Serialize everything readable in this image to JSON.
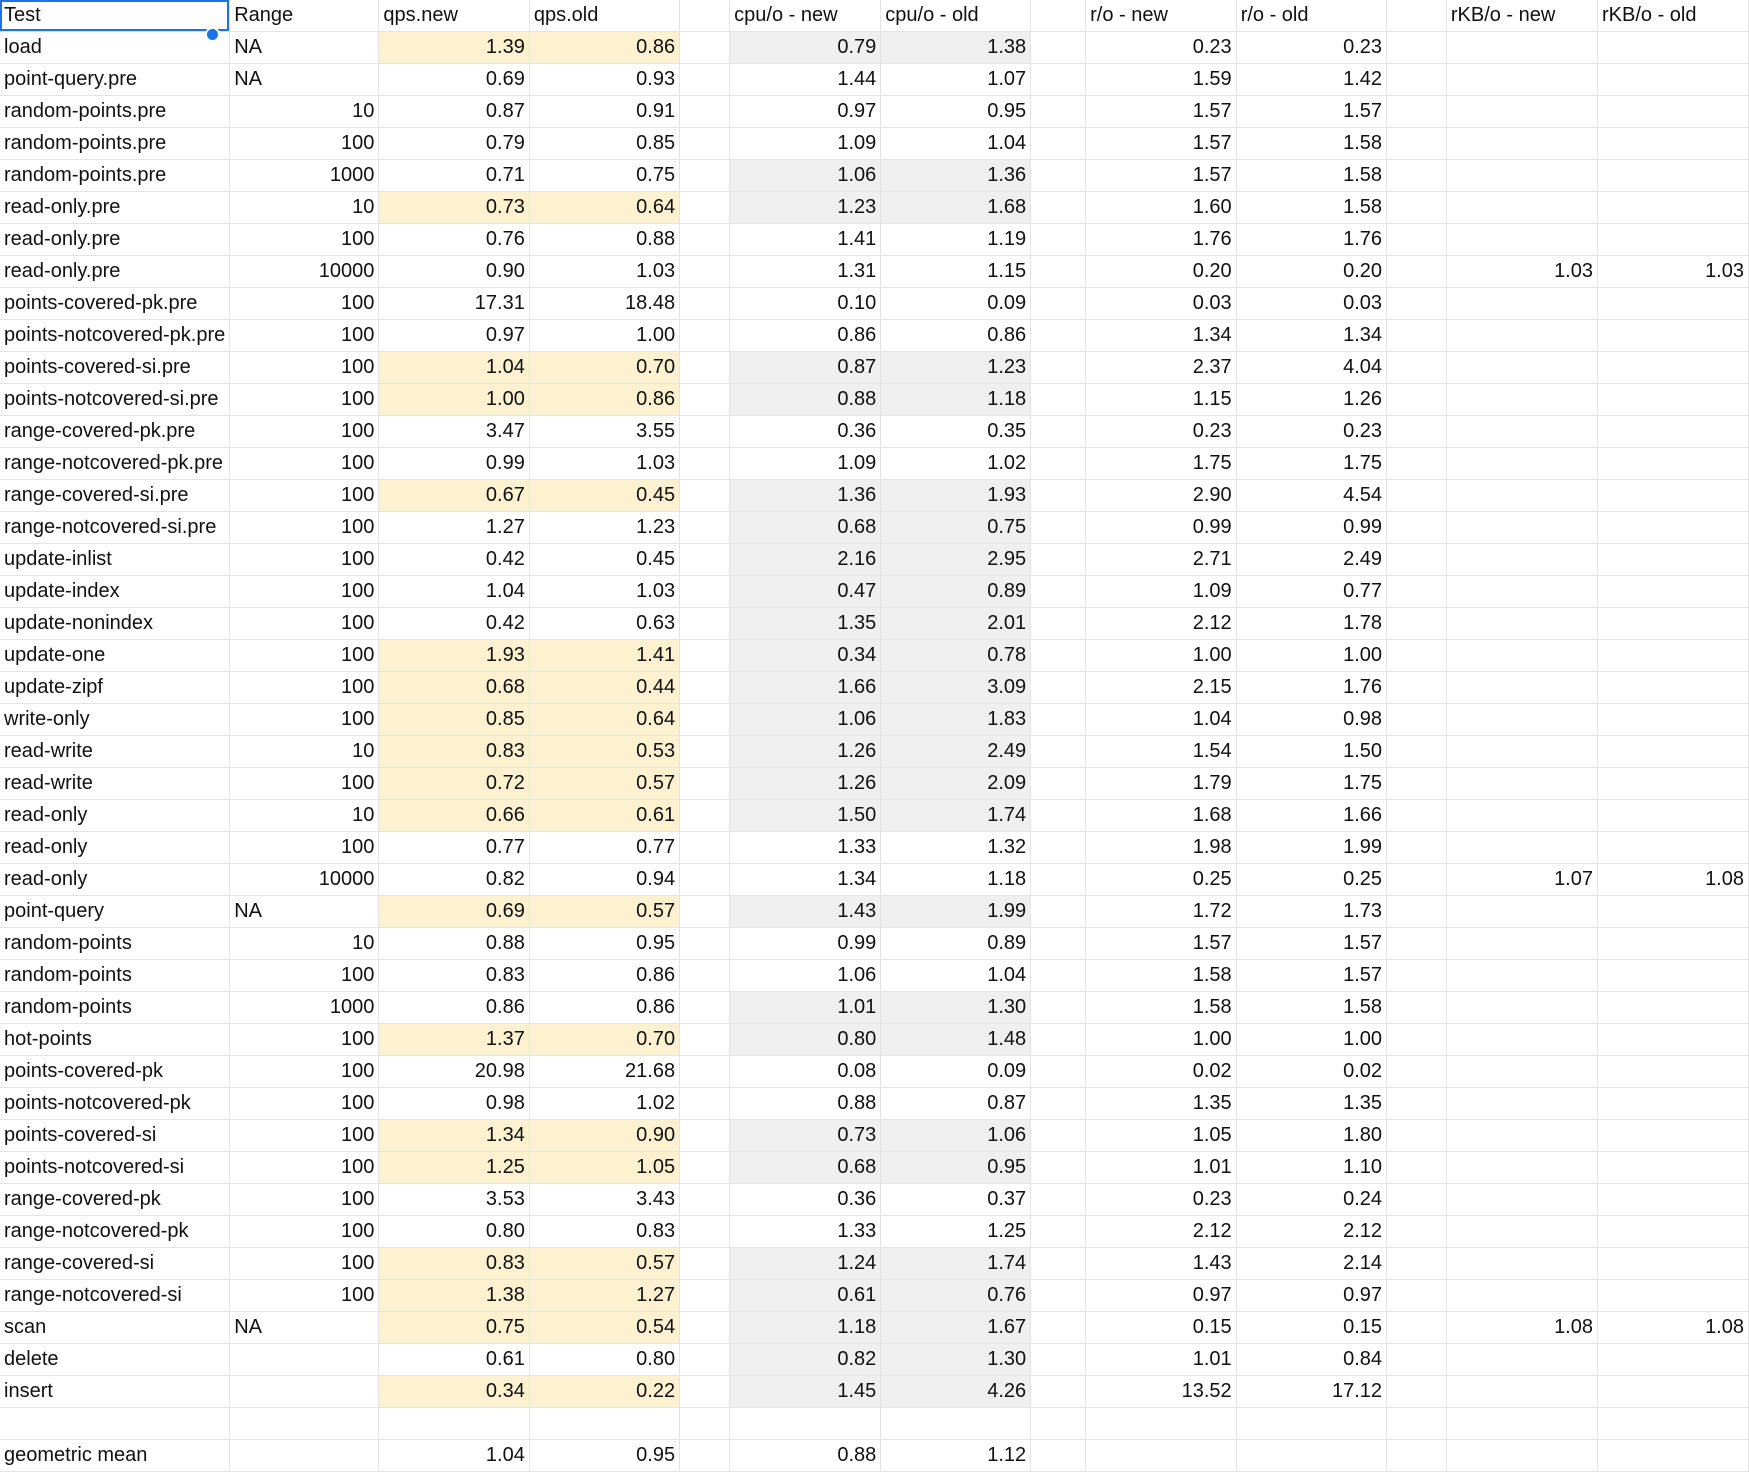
{
  "colors": {
    "highlight_qps": "#fdf1cf",
    "highlight_cpu": "#efefef",
    "selection": "#1a73e8",
    "gridline": "#e2e3e3"
  },
  "header": [
    "Test",
    "Range",
    "qps.new",
    "qps.old",
    "",
    "cpu/o - new",
    "cpu/o - old",
    "",
    "r/o - new",
    "r/o - old",
    "",
    "rKB/o - new",
    "rKB/o - old"
  ],
  "rows": [
    {
      "test": "load",
      "range": "NA",
      "qps_new": "1.39",
      "qps_old": "0.86",
      "cpu_new": "0.79",
      "cpu_old": "1.38",
      "ro_new": "0.23",
      "ro_old": "0.23",
      "rkb_new": "",
      "rkb_old": "",
      "hl": true
    },
    {
      "test": "point-query.pre",
      "range": "NA",
      "qps_new": "0.69",
      "qps_old": "0.93",
      "cpu_new": "1.44",
      "cpu_old": "1.07",
      "ro_new": "1.59",
      "ro_old": "1.42",
      "rkb_new": "",
      "rkb_old": "",
      "hl": false
    },
    {
      "test": "random-points.pre",
      "range": "10",
      "qps_new": "0.87",
      "qps_old": "0.91",
      "cpu_new": "0.97",
      "cpu_old": "0.95",
      "ro_new": "1.57",
      "ro_old": "1.57",
      "rkb_new": "",
      "rkb_old": "",
      "hl": false
    },
    {
      "test": "random-points.pre",
      "range": "100",
      "qps_new": "0.79",
      "qps_old": "0.85",
      "cpu_new": "1.09",
      "cpu_old": "1.04",
      "ro_new": "1.57",
      "ro_old": "1.58",
      "rkb_new": "",
      "rkb_old": "",
      "hl": false
    },
    {
      "test": "random-points.pre",
      "range": "1000",
      "qps_new": "0.71",
      "qps_old": "0.75",
      "cpu_new": "1.06",
      "cpu_old": "1.36",
      "ro_new": "1.57",
      "ro_old": "1.58",
      "rkb_new": "",
      "rkb_old": "",
      "hl": false,
      "hl_cpu": true
    },
    {
      "test": "read-only.pre",
      "range": "10",
      "qps_new": "0.73",
      "qps_old": "0.64",
      "cpu_new": "1.23",
      "cpu_old": "1.68",
      "ro_new": "1.60",
      "ro_old": "1.58",
      "rkb_new": "",
      "rkb_old": "",
      "hl": true
    },
    {
      "test": "read-only.pre",
      "range": "100",
      "qps_new": "0.76",
      "qps_old": "0.88",
      "cpu_new": "1.41",
      "cpu_old": "1.19",
      "ro_new": "1.76",
      "ro_old": "1.76",
      "rkb_new": "",
      "rkb_old": "",
      "hl": false
    },
    {
      "test": "read-only.pre",
      "range": "10000",
      "qps_new": "0.90",
      "qps_old": "1.03",
      "cpu_new": "1.31",
      "cpu_old": "1.15",
      "ro_new": "0.20",
      "ro_old": "0.20",
      "rkb_new": "1.03",
      "rkb_old": "1.03",
      "hl": false
    },
    {
      "test": "points-covered-pk.pre",
      "range": "100",
      "qps_new": "17.31",
      "qps_old": "18.48",
      "cpu_new": "0.10",
      "cpu_old": "0.09",
      "ro_new": "0.03",
      "ro_old": "0.03",
      "rkb_new": "",
      "rkb_old": "",
      "hl": false
    },
    {
      "test": "points-notcovered-pk.pre",
      "range": "100",
      "qps_new": "0.97",
      "qps_old": "1.00",
      "cpu_new": "0.86",
      "cpu_old": "0.86",
      "ro_new": "1.34",
      "ro_old": "1.34",
      "rkb_new": "",
      "rkb_old": "",
      "hl": false
    },
    {
      "test": "points-covered-si.pre",
      "range": "100",
      "qps_new": "1.04",
      "qps_old": "0.70",
      "cpu_new": "0.87",
      "cpu_old": "1.23",
      "ro_new": "2.37",
      "ro_old": "4.04",
      "rkb_new": "",
      "rkb_old": "",
      "hl": true
    },
    {
      "test": "points-notcovered-si.pre",
      "range": "100",
      "qps_new": "1.00",
      "qps_old": "0.86",
      "cpu_new": "0.88",
      "cpu_old": "1.18",
      "ro_new": "1.15",
      "ro_old": "1.26",
      "rkb_new": "",
      "rkb_old": "",
      "hl": true
    },
    {
      "test": "range-covered-pk.pre",
      "range": "100",
      "qps_new": "3.47",
      "qps_old": "3.55",
      "cpu_new": "0.36",
      "cpu_old": "0.35",
      "ro_new": "0.23",
      "ro_old": "0.23",
      "rkb_new": "",
      "rkb_old": "",
      "hl": false
    },
    {
      "test": "range-notcovered-pk.pre",
      "range": "100",
      "qps_new": "0.99",
      "qps_old": "1.03",
      "cpu_new": "1.09",
      "cpu_old": "1.02",
      "ro_new": "1.75",
      "ro_old": "1.75",
      "rkb_new": "",
      "rkb_old": "",
      "hl": false
    },
    {
      "test": "range-covered-si.pre",
      "range": "100",
      "qps_new": "0.67",
      "qps_old": "0.45",
      "cpu_new": "1.36",
      "cpu_old": "1.93",
      "ro_new": "2.90",
      "ro_old": "4.54",
      "rkb_new": "",
      "rkb_old": "",
      "hl": true
    },
    {
      "test": "range-notcovered-si.pre",
      "range": "100",
      "qps_new": "1.27",
      "qps_old": "1.23",
      "cpu_new": "0.68",
      "cpu_old": "0.75",
      "ro_new": "0.99",
      "ro_old": "0.99",
      "rkb_new": "",
      "rkb_old": "",
      "hl": false,
      "hl_cpu": true
    },
    {
      "test": "update-inlist",
      "range": "100",
      "qps_new": "0.42",
      "qps_old": "0.45",
      "cpu_new": "2.16",
      "cpu_old": "2.95",
      "ro_new": "2.71",
      "ro_old": "2.49",
      "rkb_new": "",
      "rkb_old": "",
      "hl": false,
      "hl_cpu": true
    },
    {
      "test": "update-index",
      "range": "100",
      "qps_new": "1.04",
      "qps_old": "1.03",
      "cpu_new": "0.47",
      "cpu_old": "0.89",
      "ro_new": "1.09",
      "ro_old": "0.77",
      "rkb_new": "",
      "rkb_old": "",
      "hl": false,
      "hl_cpu": true
    },
    {
      "test": "update-nonindex",
      "range": "100",
      "qps_new": "0.42",
      "qps_old": "0.63",
      "cpu_new": "1.35",
      "cpu_old": "2.01",
      "ro_new": "2.12",
      "ro_old": "1.78",
      "rkb_new": "",
      "rkb_old": "",
      "hl": false,
      "hl_cpu": true
    },
    {
      "test": "update-one",
      "range": "100",
      "qps_new": "1.93",
      "qps_old": "1.41",
      "cpu_new": "0.34",
      "cpu_old": "0.78",
      "ro_new": "1.00",
      "ro_old": "1.00",
      "rkb_new": "",
      "rkb_old": "",
      "hl": true
    },
    {
      "test": "update-zipf",
      "range": "100",
      "qps_new": "0.68",
      "qps_old": "0.44",
      "cpu_new": "1.66",
      "cpu_old": "3.09",
      "ro_new": "2.15",
      "ro_old": "1.76",
      "rkb_new": "",
      "rkb_old": "",
      "hl": true
    },
    {
      "test": "write-only",
      "range": "100",
      "qps_new": "0.85",
      "qps_old": "0.64",
      "cpu_new": "1.06",
      "cpu_old": "1.83",
      "ro_new": "1.04",
      "ro_old": "0.98",
      "rkb_new": "",
      "rkb_old": "",
      "hl": true
    },
    {
      "test": "read-write",
      "range": "10",
      "qps_new": "0.83",
      "qps_old": "0.53",
      "cpu_new": "1.26",
      "cpu_old": "2.49",
      "ro_new": "1.54",
      "ro_old": "1.50",
      "rkb_new": "",
      "rkb_old": "",
      "hl": true
    },
    {
      "test": "read-write",
      "range": "100",
      "qps_new": "0.72",
      "qps_old": "0.57",
      "cpu_new": "1.26",
      "cpu_old": "2.09",
      "ro_new": "1.79",
      "ro_old": "1.75",
      "rkb_new": "",
      "rkb_old": "",
      "hl": true
    },
    {
      "test": "read-only",
      "range": "10",
      "qps_new": "0.66",
      "qps_old": "0.61",
      "cpu_new": "1.50",
      "cpu_old": "1.74",
      "ro_new": "1.68",
      "ro_old": "1.66",
      "rkb_new": "",
      "rkb_old": "",
      "hl": true
    },
    {
      "test": "read-only",
      "range": "100",
      "qps_new": "0.77",
      "qps_old": "0.77",
      "cpu_new": "1.33",
      "cpu_old": "1.32",
      "ro_new": "1.98",
      "ro_old": "1.99",
      "rkb_new": "",
      "rkb_old": "",
      "hl": false
    },
    {
      "test": "read-only",
      "range": "10000",
      "qps_new": "0.82",
      "qps_old": "0.94",
      "cpu_new": "1.34",
      "cpu_old": "1.18",
      "ro_new": "0.25",
      "ro_old": "0.25",
      "rkb_new": "1.07",
      "rkb_old": "1.08",
      "hl": false
    },
    {
      "test": "point-query",
      "range": "NA",
      "qps_new": "0.69",
      "qps_old": "0.57",
      "cpu_new": "1.43",
      "cpu_old": "1.99",
      "ro_new": "1.72",
      "ro_old": "1.73",
      "rkb_new": "",
      "rkb_old": "",
      "hl": true
    },
    {
      "test": "random-points",
      "range": "10",
      "qps_new": "0.88",
      "qps_old": "0.95",
      "cpu_new": "0.99",
      "cpu_old": "0.89",
      "ro_new": "1.57",
      "ro_old": "1.57",
      "rkb_new": "",
      "rkb_old": "",
      "hl": false
    },
    {
      "test": "random-points",
      "range": "100",
      "qps_new": "0.83",
      "qps_old": "0.86",
      "cpu_new": "1.06",
      "cpu_old": "1.04",
      "ro_new": "1.58",
      "ro_old": "1.57",
      "rkb_new": "",
      "rkb_old": "",
      "hl": false
    },
    {
      "test": "random-points",
      "range": "1000",
      "qps_new": "0.86",
      "qps_old": "0.86",
      "cpu_new": "1.01",
      "cpu_old": "1.30",
      "ro_new": "1.58",
      "ro_old": "1.58",
      "rkb_new": "",
      "rkb_old": "",
      "hl": false,
      "hl_cpu": true
    },
    {
      "test": "hot-points",
      "range": "100",
      "qps_new": "1.37",
      "qps_old": "0.70",
      "cpu_new": "0.80",
      "cpu_old": "1.48",
      "ro_new": "1.00",
      "ro_old": "1.00",
      "rkb_new": "",
      "rkb_old": "",
      "hl": true
    },
    {
      "test": "points-covered-pk",
      "range": "100",
      "qps_new": "20.98",
      "qps_old": "21.68",
      "cpu_new": "0.08",
      "cpu_old": "0.09",
      "ro_new": "0.02",
      "ro_old": "0.02",
      "rkb_new": "",
      "rkb_old": "",
      "hl": false
    },
    {
      "test": "points-notcovered-pk",
      "range": "100",
      "qps_new": "0.98",
      "qps_old": "1.02",
      "cpu_new": "0.88",
      "cpu_old": "0.87",
      "ro_new": "1.35",
      "ro_old": "1.35",
      "rkb_new": "",
      "rkb_old": "",
      "hl": false
    },
    {
      "test": "points-covered-si",
      "range": "100",
      "qps_new": "1.34",
      "qps_old": "0.90",
      "cpu_new": "0.73",
      "cpu_old": "1.06",
      "ro_new": "1.05",
      "ro_old": "1.80",
      "rkb_new": "",
      "rkb_old": "",
      "hl": true
    },
    {
      "test": "points-notcovered-si",
      "range": "100",
      "qps_new": "1.25",
      "qps_old": "1.05",
      "cpu_new": "0.68",
      "cpu_old": "0.95",
      "ro_new": "1.01",
      "ro_old": "1.10",
      "rkb_new": "",
      "rkb_old": "",
      "hl": true
    },
    {
      "test": "range-covered-pk",
      "range": "100",
      "qps_new": "3.53",
      "qps_old": "3.43",
      "cpu_new": "0.36",
      "cpu_old": "0.37",
      "ro_new": "0.23",
      "ro_old": "0.24",
      "rkb_new": "",
      "rkb_old": "",
      "hl": false
    },
    {
      "test": "range-notcovered-pk",
      "range": "100",
      "qps_new": "0.80",
      "qps_old": "0.83",
      "cpu_new": "1.33",
      "cpu_old": "1.25",
      "ro_new": "2.12",
      "ro_old": "2.12",
      "rkb_new": "",
      "rkb_old": "",
      "hl": false
    },
    {
      "test": "range-covered-si",
      "range": "100",
      "qps_new": "0.83",
      "qps_old": "0.57",
      "cpu_new": "1.24",
      "cpu_old": "1.74",
      "ro_new": "1.43",
      "ro_old": "2.14",
      "rkb_new": "",
      "rkb_old": "",
      "hl": true
    },
    {
      "test": "range-notcovered-si",
      "range": "100",
      "qps_new": "1.38",
      "qps_old": "1.27",
      "cpu_new": "0.61",
      "cpu_old": "0.76",
      "ro_new": "0.97",
      "ro_old": "0.97",
      "rkb_new": "",
      "rkb_old": "",
      "hl": true
    },
    {
      "test": "scan",
      "range": "NA",
      "qps_new": "0.75",
      "qps_old": "0.54",
      "cpu_new": "1.18",
      "cpu_old": "1.67",
      "ro_new": "0.15",
      "ro_old": "0.15",
      "rkb_new": "1.08",
      "rkb_old": "1.08",
      "hl": true
    },
    {
      "test": "delete",
      "range": "",
      "qps_new": "0.61",
      "qps_old": "0.80",
      "cpu_new": "0.82",
      "cpu_old": "1.30",
      "ro_new": "1.01",
      "ro_old": "0.84",
      "rkb_new": "",
      "rkb_old": "",
      "hl": false,
      "hl_cpu": true
    },
    {
      "test": "insert",
      "range": "",
      "qps_new": "0.34",
      "qps_old": "0.22",
      "cpu_new": "1.45",
      "cpu_old": "4.26",
      "ro_new": "13.52",
      "ro_old": "17.12",
      "rkb_new": "",
      "rkb_old": "",
      "hl": true
    },
    {
      "test": "",
      "range": "",
      "qps_new": "",
      "qps_old": "",
      "cpu_new": "",
      "cpu_old": "",
      "ro_new": "",
      "ro_old": "",
      "rkb_new": "",
      "rkb_old": "",
      "hl": false
    },
    {
      "test": "geometric mean",
      "range": "",
      "qps_new": "1.04",
      "qps_old": "0.95",
      "cpu_new": "0.88",
      "cpu_old": "1.12",
      "ro_new": "",
      "ro_old": "",
      "rkb_new": "",
      "rkb_old": "",
      "hl": false
    }
  ]
}
